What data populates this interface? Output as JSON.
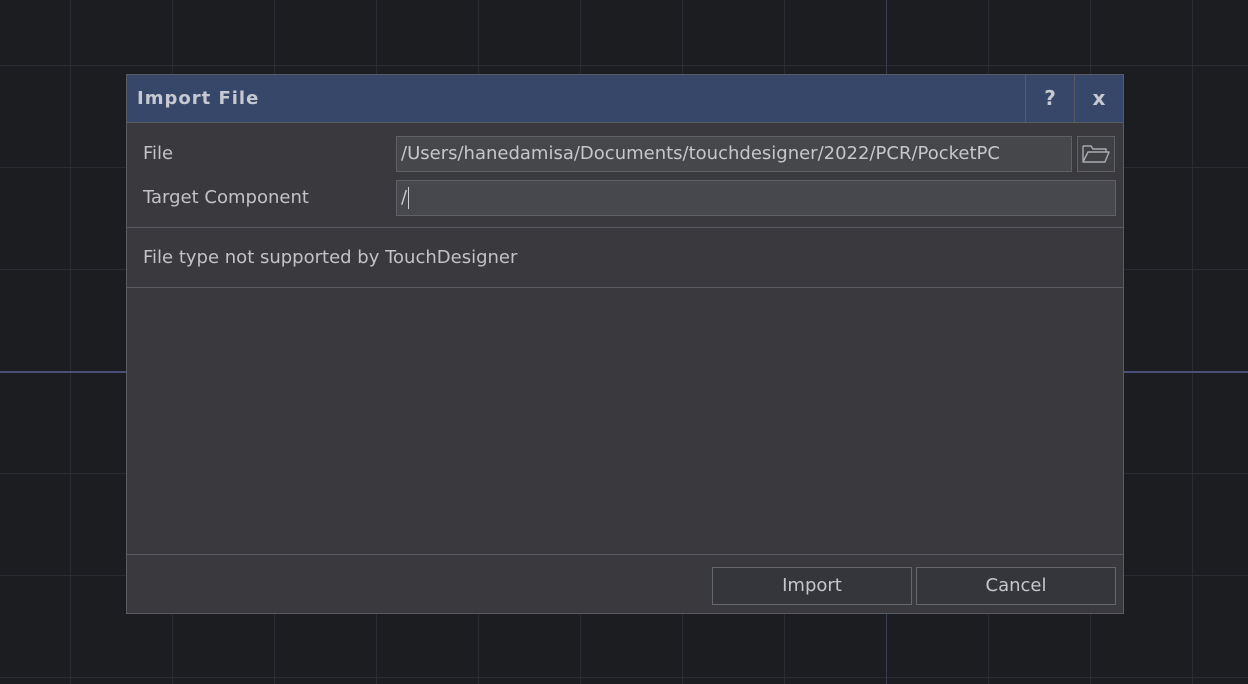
{
  "dialog": {
    "title": "Import File",
    "help_label": "?",
    "close_label": "x"
  },
  "form": {
    "file_label": "File",
    "file_value": "/Users/hanedamisa/Documents/touchdesigner/2022/PCR/PocketPC",
    "target_label": "Target Component",
    "target_value": "/"
  },
  "status": {
    "message": "File type not supported by TouchDesigner"
  },
  "footer": {
    "import_label": "Import",
    "cancel_label": "Cancel"
  },
  "icons": {
    "browse": "folder-open-icon"
  },
  "colors": {
    "titlebar": "#374769",
    "dialog_bg": "#3a3a3e",
    "workspace_bg": "#1c1d21"
  }
}
